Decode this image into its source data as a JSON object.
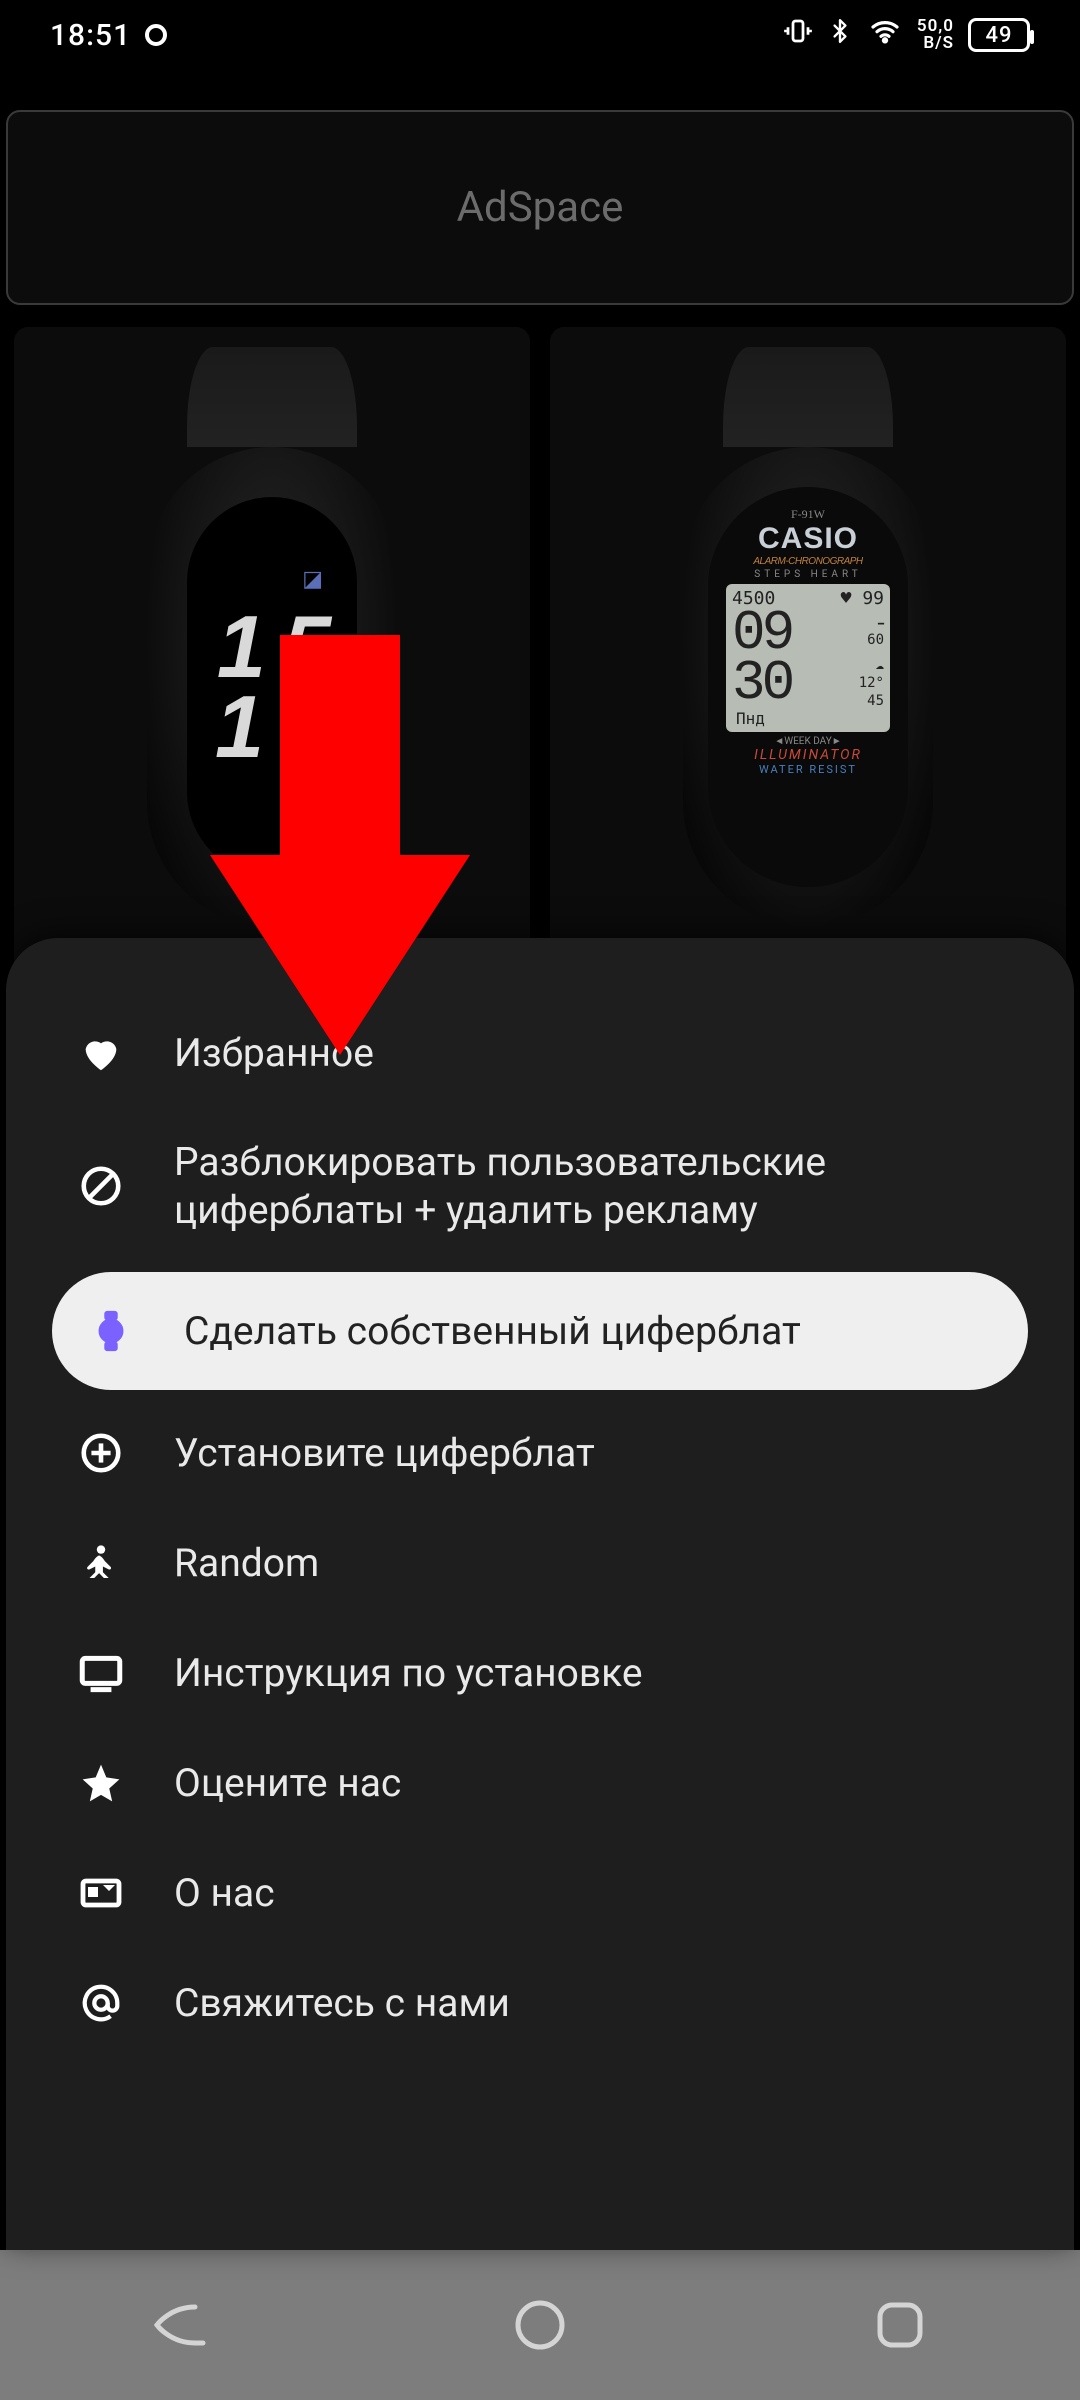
{
  "status": {
    "time": "18:51",
    "net_top": "50,0",
    "net_bottom": "B/S",
    "battery": "49"
  },
  "adspace": {
    "label": "AdSpace"
  },
  "watchface1": {
    "line1": "1 5",
    "line2": "1"
  },
  "watchface2": {
    "model": "F-91W",
    "brand": "CASIO",
    "sub": "ALARM-CHRONOGRAPH",
    "labels": "STEPS   HEART",
    "steps": "4500",
    "heart": "♥ 99",
    "hours": "09",
    "minutes": "30",
    "temp1": "60",
    "temp2": "12°",
    "temp3": "45",
    "day": "Пнд",
    "week_day": "◄WEEK    DAY►",
    "illuminator": "ILLUMINATOR",
    "water": "WATER  RESIST"
  },
  "menu": {
    "favorites": "Избранное",
    "unlock": "Разблокировать пользовательские циферблаты + удалить рекламу",
    "create": "Сделать собственный циферблат",
    "install": "Установите циферблат",
    "random": "Random",
    "instructions": "Инструкция по установке",
    "rate": "Оцените нас",
    "about": "О нас",
    "contact": "Свяжитесь с нами"
  }
}
